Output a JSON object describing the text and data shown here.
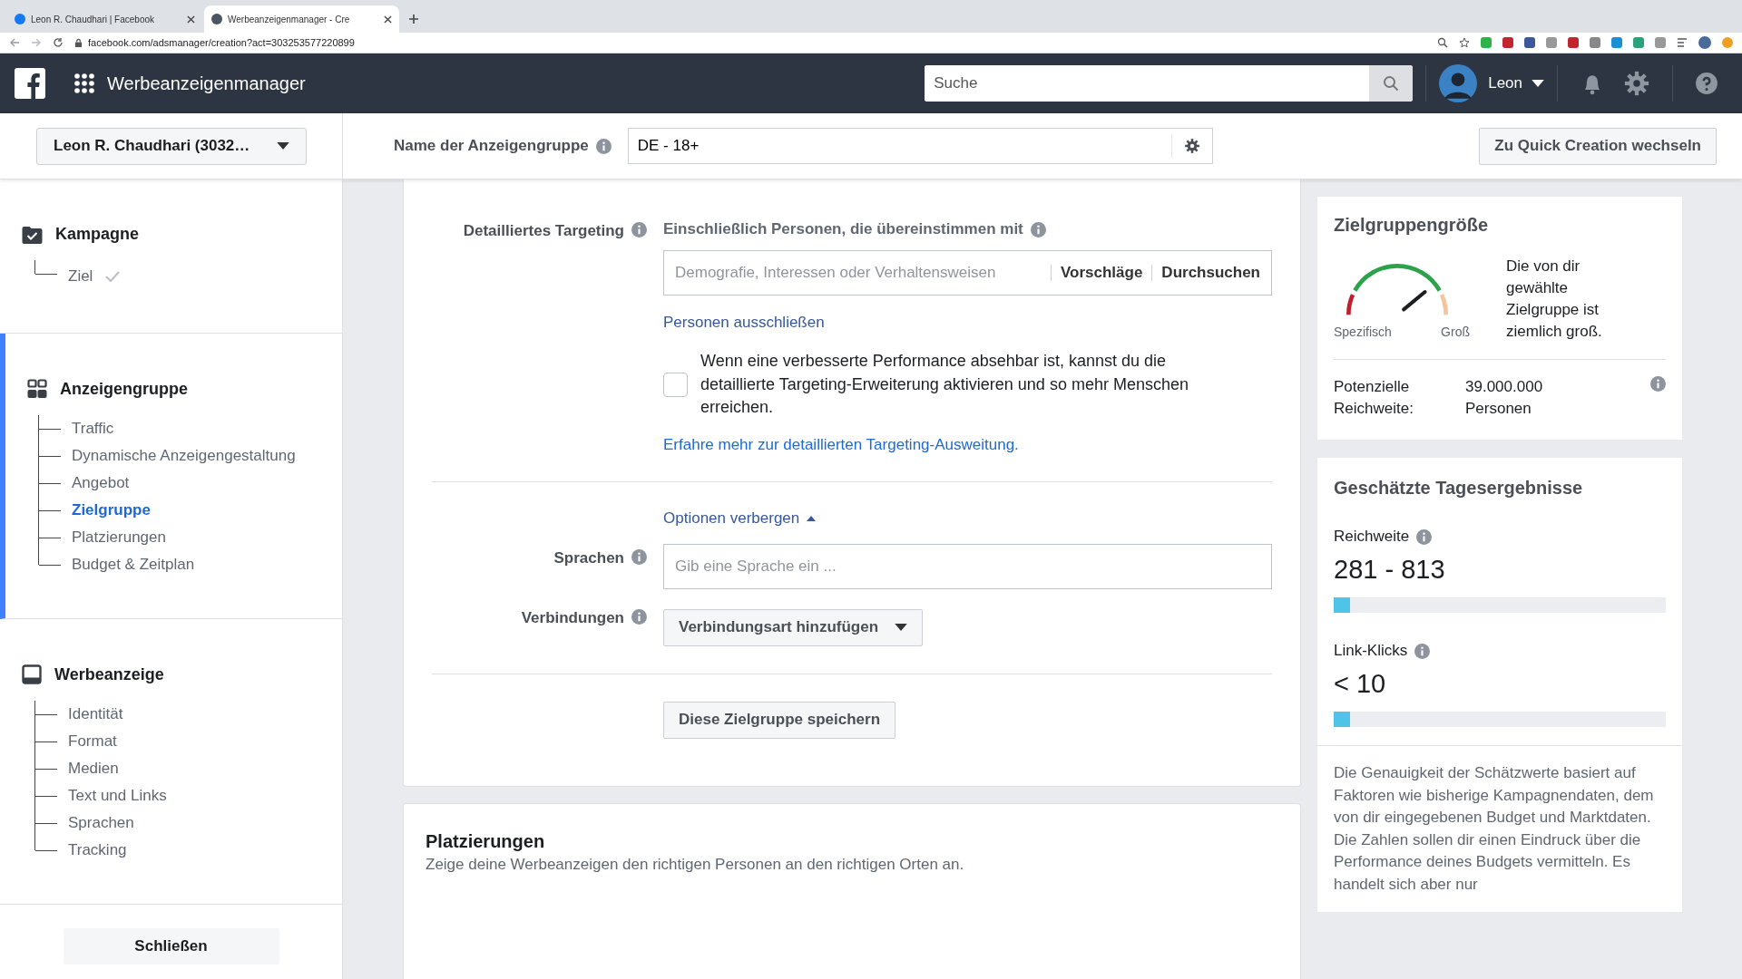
{
  "browser": {
    "tabs": [
      {
        "title": "Leon R. Chaudhari | Facebook",
        "selected": false
      },
      {
        "title": "Werbeanzeigenmanager - Cre",
        "selected": true
      }
    ],
    "url": "facebook.com/adsmanager/creation?act=303253577220899"
  },
  "header": {
    "app_title": "Werbeanzeigenmanager",
    "search": {
      "placeholder": "Suche"
    },
    "user": "Leon"
  },
  "subheader": {
    "account": "Leon R. Chaudhari (3032…",
    "name_label": "Name der Anzeigengruppe",
    "name_value": "DE - 18+",
    "switch_button": "Zu Quick Creation wechseln"
  },
  "sidebar": {
    "sections": [
      {
        "kind": "campaign",
        "title": "Kampagne",
        "active": false,
        "items": [
          {
            "label": "Ziel",
            "selected": false,
            "done": true
          }
        ]
      },
      {
        "kind": "adset",
        "title": "Anzeigengruppe",
        "active": true,
        "items": [
          {
            "label": "Traffic",
            "selected": false,
            "done": false
          },
          {
            "label": "Dynamische Anzeigengestaltung",
            "selected": false,
            "done": false
          },
          {
            "label": "Angebot",
            "selected": false,
            "done": false
          },
          {
            "label": "Zielgruppe",
            "selected": true,
            "done": false
          },
          {
            "label": "Platzierungen",
            "selected": false,
            "done": false
          },
          {
            "label": "Budget & Zeitplan",
            "selected": false,
            "done": false
          }
        ]
      },
      {
        "kind": "ad",
        "title": "Werbeanzeige",
        "active": false,
        "items": [
          {
            "label": "Identität",
            "selected": false,
            "done": false
          },
          {
            "label": "Format",
            "selected": false,
            "done": false
          },
          {
            "label": "Medien",
            "selected": false,
            "done": false
          },
          {
            "label": "Text und Links",
            "selected": false,
            "done": false
          },
          {
            "label": "Sprachen",
            "selected": false,
            "done": false
          },
          {
            "label": "Tracking",
            "selected": false,
            "done": false
          }
        ]
      }
    ],
    "close_button": "Schließen"
  },
  "targeting": {
    "label": "Detailliertes Targeting",
    "include_label": "Einschließlich Personen, die übereinstimmen mit",
    "placeholder": "Demografie, Interessen oder Verhaltensweisen",
    "actions": [
      "Vorschläge",
      "Durchsuchen"
    ],
    "exclude_link": "Personen ausschließen",
    "expansion": {
      "checked": false,
      "text": "Wenn eine verbesserte Performance absehbar ist, kannst du die detaillierte Targeting-Erweiterung aktivieren und so mehr Menschen erreichen."
    },
    "learn_more": "Erfahre mehr zur detaillierten Targeting-Ausweitung."
  },
  "options_toggle": {
    "label": "Optionen verbergen",
    "expanded": true
  },
  "languages": {
    "label": "Sprachen",
    "placeholder": "Gib eine Sprache ein ..."
  },
  "connections": {
    "label": "Verbindungen",
    "button": "Verbindungsart hinzufügen"
  },
  "save_button": "Diese Zielgruppe speichern",
  "placements": {
    "title": "Platzierungen",
    "subtitle": "Zeige deine Werbeanzeigen den richtigen Personen an den richtigen Orten an."
  },
  "audience_size": {
    "title": "Zielgruppengröße",
    "gauge": {
      "level": 0.78,
      "min_label": "Spezifisch",
      "max_label": "Groß"
    },
    "description": "Die von dir gewählte Zielgruppe ist ziemlich groß.",
    "reach_label": "Potenzielle Reichweite:",
    "reach_value": "39.000.000 Personen"
  },
  "estimates": {
    "title": "Geschätzte Tagesergebnisse",
    "metrics": [
      {
        "label": "Reichweite",
        "value": "281 - 813",
        "level": 0.05
      },
      {
        "label": "Link-Klicks",
        "value": "< 10",
        "level": 0.05
      }
    ],
    "note": "Die Genauigkeit der Schätzwerte basiert auf Faktoren wie bisherige Kampagnendaten, dem von dir eingegebenen Budget und Marktdaten. Die Zahlen sollen dir einen Eindruck über die Performance deines Budgets vermitteln. Es handelt sich aber nur"
  }
}
